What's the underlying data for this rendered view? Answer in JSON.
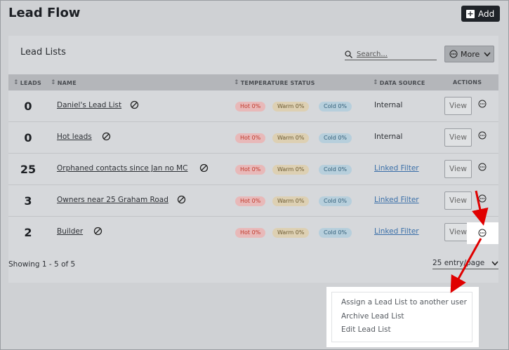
{
  "header": {
    "title": "Lead Flow",
    "add_label": "Add"
  },
  "card": {
    "title": "Lead Lists",
    "search_placeholder": "Search...",
    "more_label": "More"
  },
  "table": {
    "columns": {
      "leads": "LEADS",
      "name": "NAME",
      "temperature": "TEMPERATURE STATUS",
      "source": "DATA SOURCE",
      "actions": "ACTIONS"
    },
    "rows": [
      {
        "leads": "0",
        "name": "Daniel's Lead List",
        "hot": "Hot 0%",
        "warm": "Warm 0%",
        "cold": "Cold 0%",
        "source": "Internal",
        "source_link": false,
        "view": "View"
      },
      {
        "leads": "0",
        "name": "Hot leads",
        "hot": "Hot 0%",
        "warm": "Warm 0%",
        "cold": "Cold 0%",
        "source": "Internal",
        "source_link": false,
        "view": "View"
      },
      {
        "leads": "25",
        "name": "Orphaned contacts since Jan no MC",
        "hot": "Hot 0%",
        "warm": "Warm 0%",
        "cold": "Cold 0%",
        "source": "Linked Filter",
        "source_link": true,
        "view": "View"
      },
      {
        "leads": "3",
        "name": "Owners near 25 Graham Road",
        "hot": "Hot 0%",
        "warm": "Warm 0%",
        "cold": "Cold 0%",
        "source": "Linked Filter",
        "source_link": true,
        "view": "View"
      },
      {
        "leads": "2",
        "name": "Builder",
        "hot": "Hot 0%",
        "warm": "Warm 0%",
        "cold": "Cold 0%",
        "source": "Linked Filter",
        "source_link": true,
        "view": "View"
      }
    ]
  },
  "footer": {
    "showing": "Showing 1 - 5 of 5",
    "page_size": "25 entry/page"
  },
  "context_menu": {
    "items": [
      "Assign a Lead List to another user",
      "Archive Lead List",
      "Edit Lead List"
    ]
  },
  "colors": {
    "hot_text": "#c0392b",
    "warm_text": "#6e5c33",
    "cold_text": "#34607a",
    "annotation_arrow": "#e00000",
    "link": "#3a6fa8"
  }
}
